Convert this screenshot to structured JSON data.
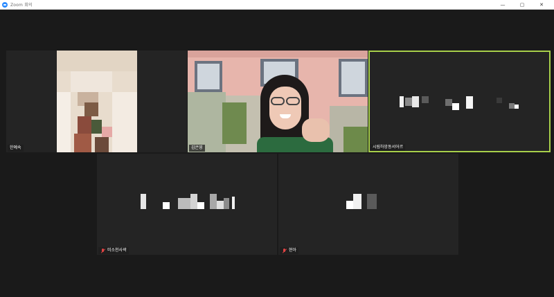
{
  "window": {
    "title": "Zoom 회의",
    "controls": [
      "—",
      "▢",
      "✕"
    ]
  },
  "participants": [
    {
      "name": "한예숙",
      "muted": false,
      "video": true
    },
    {
      "name": "김은영",
      "muted": false,
      "video": true
    },
    {
      "name": "시림하망동서어르",
      "muted": false,
      "video": false,
      "active_speaker": true
    },
    {
      "name": "미소천사곽",
      "muted": true,
      "video": false
    },
    {
      "name": "현아",
      "muted": true,
      "video": false
    }
  ],
  "colors": {
    "active_speaker_border": "#a8d04a",
    "muted_icon": "#e04444",
    "background": "#1a1a1a"
  }
}
